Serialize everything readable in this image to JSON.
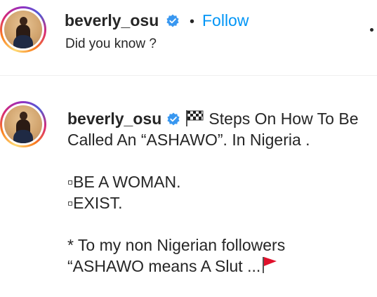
{
  "header": {
    "username": "beverly_osu",
    "separator": "•",
    "follow_label": "Follow",
    "subtitle": "Did you know ?"
  },
  "caption": {
    "username": "beverly_osu",
    "line1_text": "Steps On How To Be",
    "line2": "Called An “ASHAWO”. In Nigeria .",
    "line3": "▫BE A WOMAN.",
    "line4": "▫EXIST.",
    "line5": "* To my non Nigerian followers",
    "line6_text": "“ASHAWO means A Slut ..."
  },
  "icons": {
    "verified": "verified-badge-icon",
    "chequered_flag": "chequered-flag-icon",
    "triangular_flag": "red-triangular-flag-icon",
    "more": "more-options-icon"
  },
  "colors": {
    "link_blue": "#0095f6",
    "verified_blue": "#3897f0",
    "flag_red": "#e0102b",
    "text": "#262626"
  }
}
